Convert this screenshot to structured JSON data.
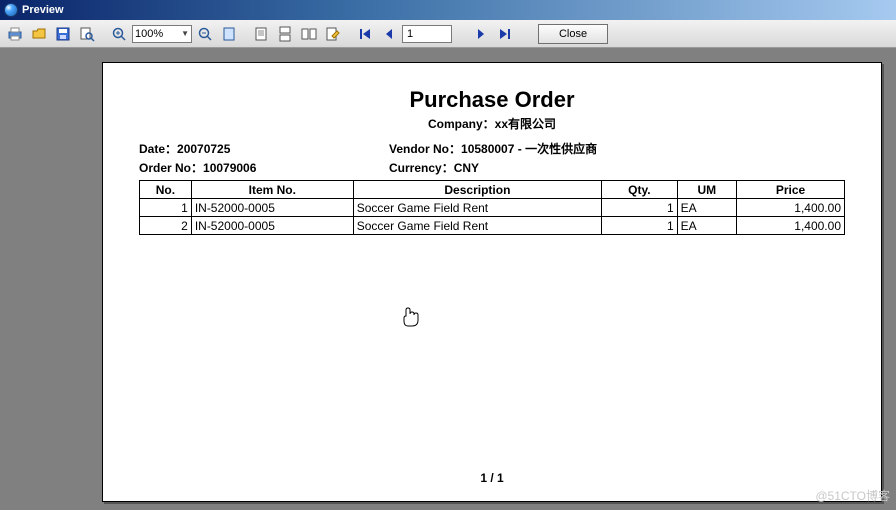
{
  "window": {
    "title": "Preview"
  },
  "toolbar": {
    "zoom": "100%",
    "page": "1",
    "close_label": "Close"
  },
  "doc": {
    "title": "Purchase Order",
    "company_label": "Company：",
    "company_value": "xx有限公司",
    "date_label": "Date：",
    "date_value": "20070725",
    "orderno_label": "Order No：",
    "orderno_value": "10079006",
    "vendor_label": "Vendor No：",
    "vendor_value": "10580007 - 一次性供应商",
    "currency_label": "Currency：",
    "currency_value": "CNY",
    "columns": [
      "No.",
      "Item No.",
      "Description",
      "Qty.",
      "UM",
      "Price"
    ],
    "rows": [
      {
        "no": "1",
        "item": "IN-52000-0005",
        "desc": "Soccer Game Field Rent",
        "qty": "1",
        "um": "EA",
        "price": "1,400.00"
      },
      {
        "no": "2",
        "item": "IN-52000-0005",
        "desc": "Soccer Game Field Rent",
        "qty": "1",
        "um": "EA",
        "price": "1,400.00"
      }
    ],
    "pager": "1 / 1"
  },
  "watermark": "@51CTO博客"
}
